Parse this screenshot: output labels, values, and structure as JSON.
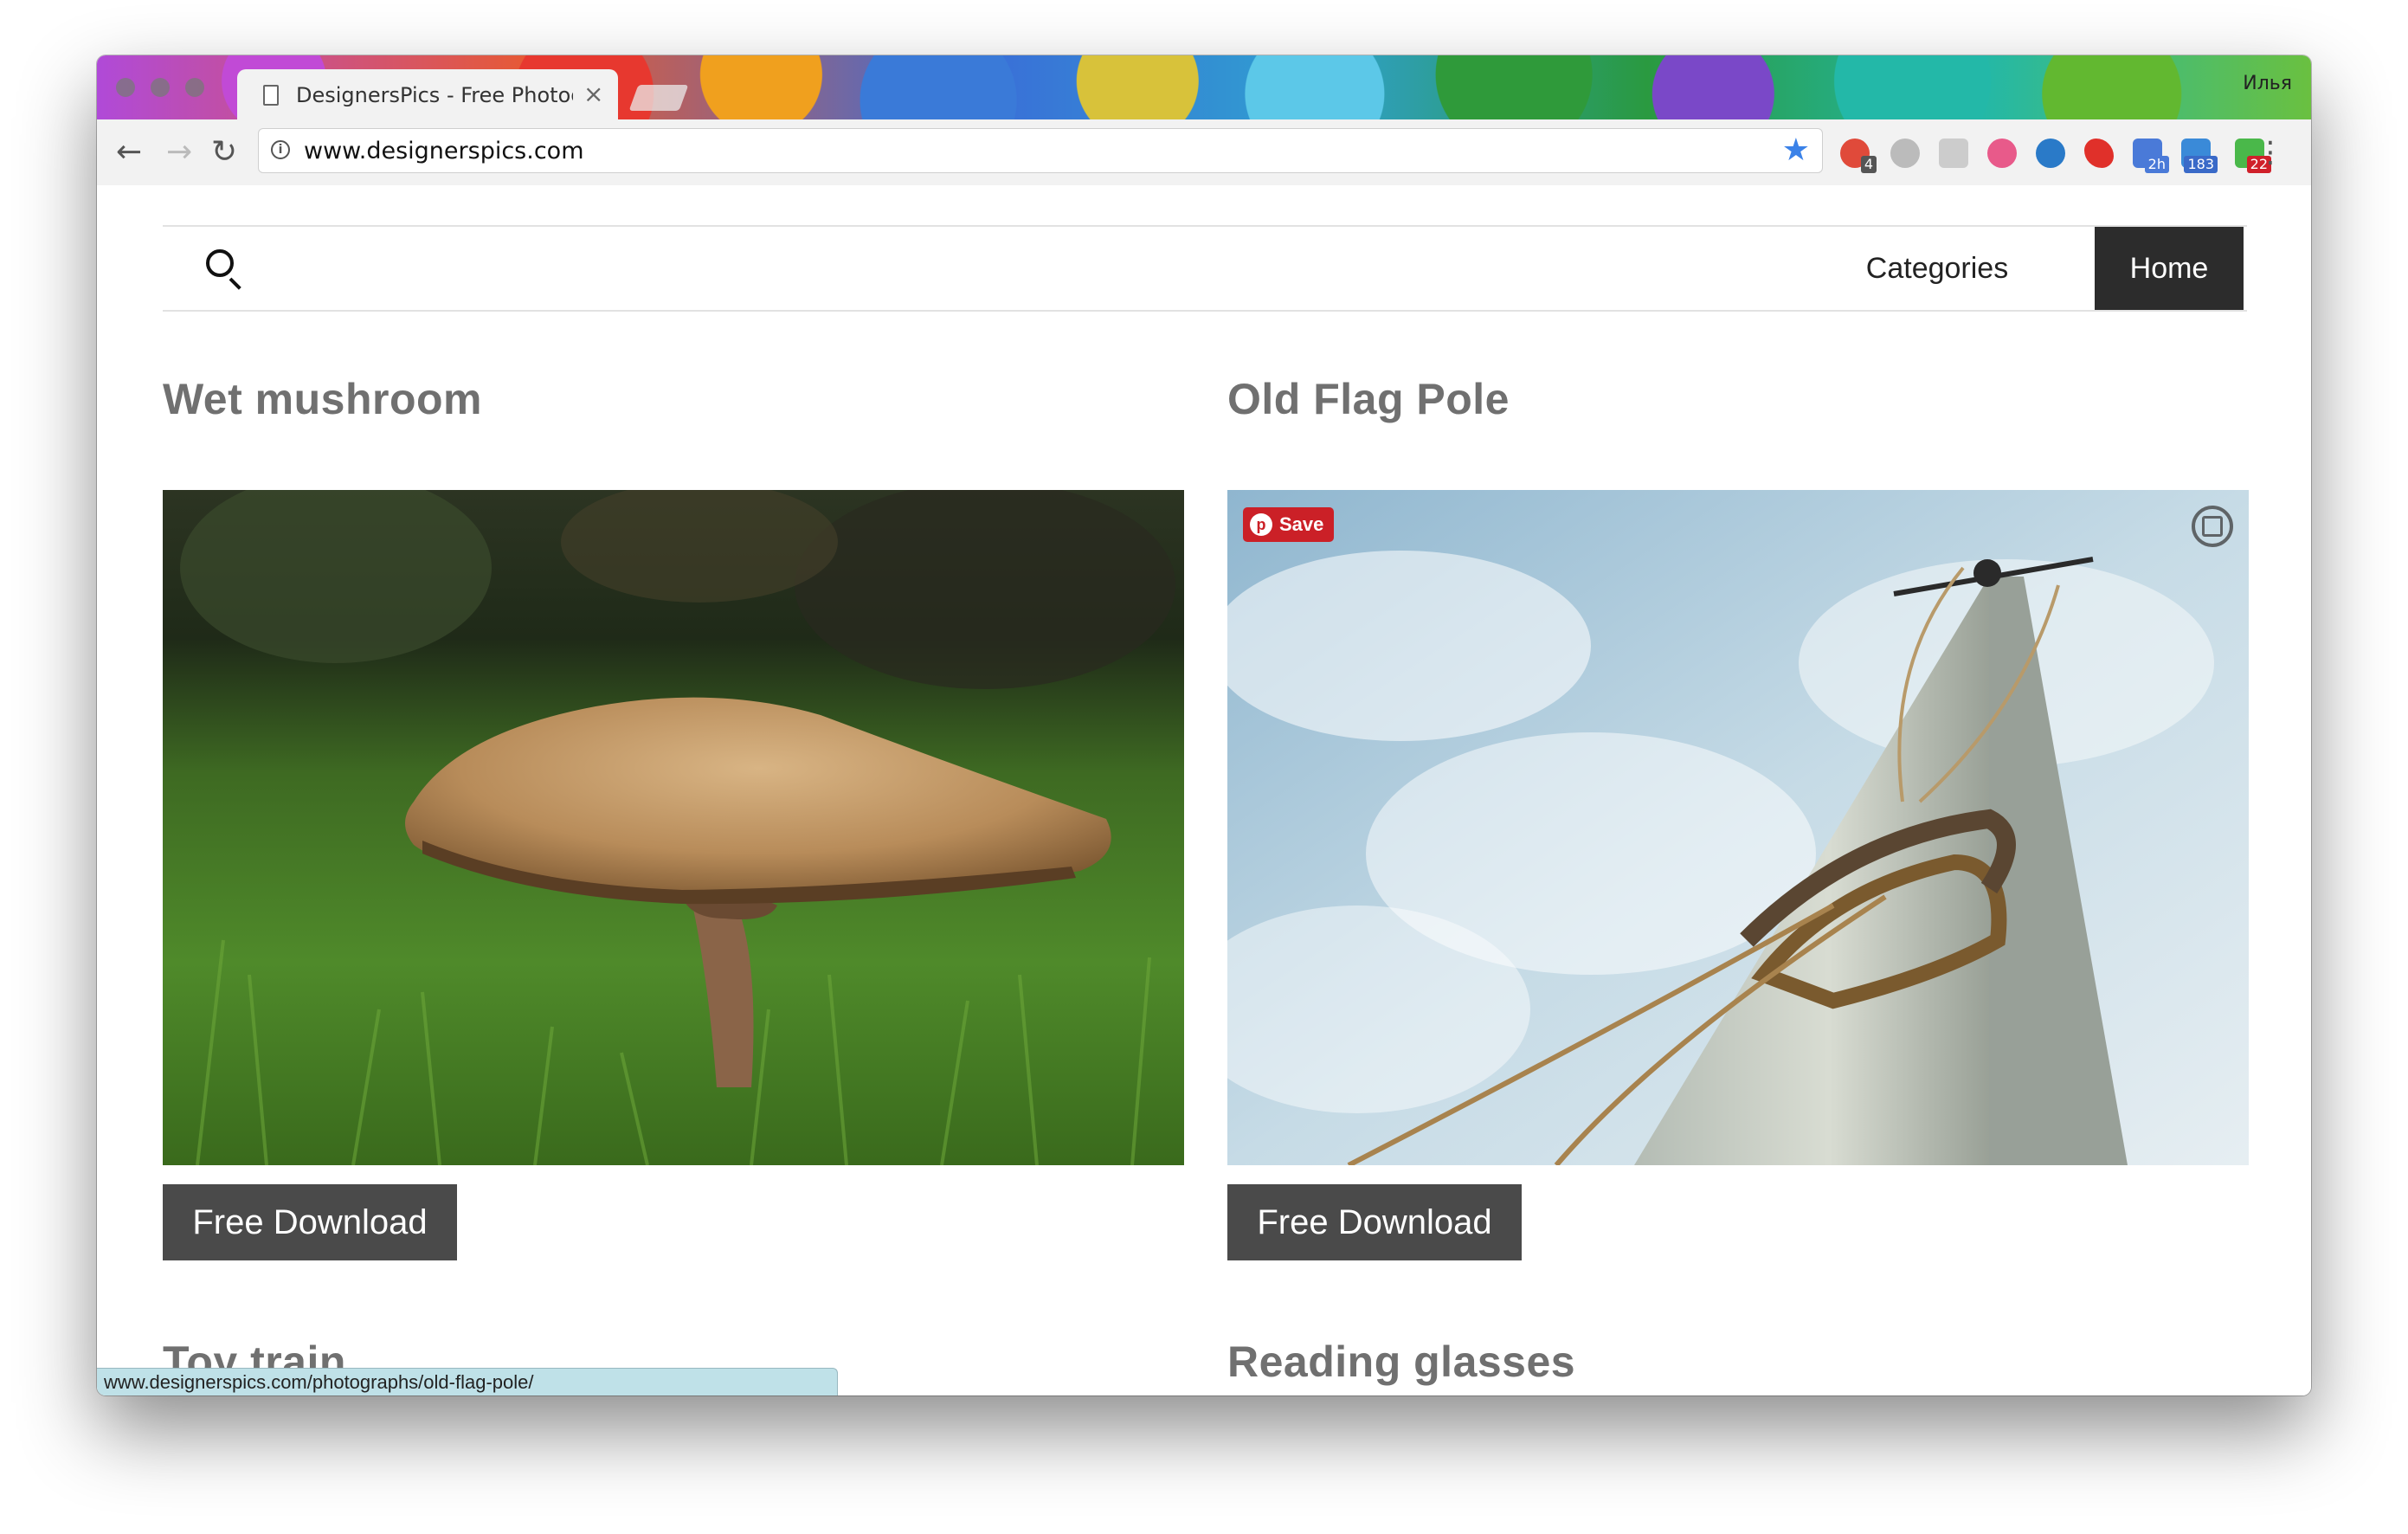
{
  "browser": {
    "tab_title": "DesignersPics - Free Photogra",
    "url": "www.designerspics.com",
    "profile_name": "Илья",
    "status_url": "www.designerspics.com/photographs/old-flag-pole/",
    "extension_badges": [
      "4",
      "2h",
      "183",
      "22"
    ]
  },
  "site_nav": {
    "categories_label": "Categories",
    "home_label": "Home"
  },
  "cards": [
    {
      "title": "Wet mushroom",
      "download_label": "Free Download"
    },
    {
      "title": "Old Flag Pole",
      "download_label": "Free Download",
      "pin_save_label": "Save"
    },
    {
      "title": "Toy train"
    },
    {
      "title": "Reading glasses"
    }
  ],
  "colors": {
    "home_bg": "#2c2c2c",
    "download_bg": "#4a4a4a",
    "title_gray": "#707070",
    "pinterest_red": "#cb2027",
    "bookmark_star": "#3b82e8"
  }
}
